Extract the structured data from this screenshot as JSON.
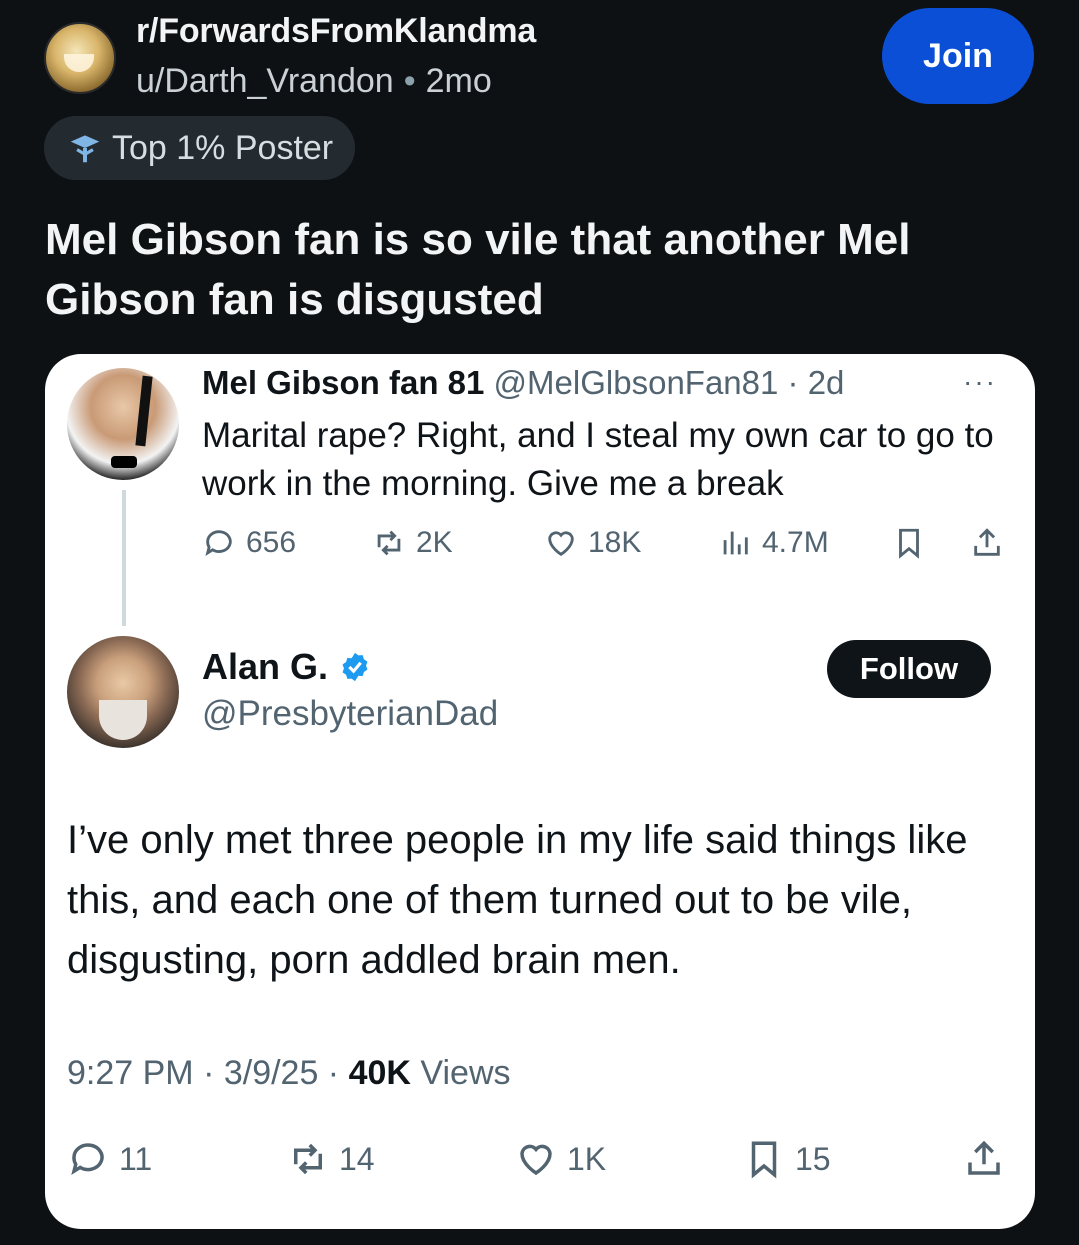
{
  "reddit": {
    "subreddit": "r/ForwardsFromKlandma",
    "username": "u/Darth_Vrandon",
    "separator": "•",
    "age": "2mo",
    "join_label": "Join",
    "flair": "Top 1% Poster",
    "post_title": "Mel Gibson fan is so vile that another Mel Gibson fan is disgusted"
  },
  "tweet1": {
    "name": "Mel Gibson fan 81",
    "handle_time": " @MelGlbsonFan81 · 2d",
    "more": "···",
    "text": "Marital rape? Right, and I steal my own car to go to work in the morning. Give me a break",
    "replies": "656",
    "reposts": "2K",
    "likes": "18K",
    "views": "4.7M"
  },
  "tweet2": {
    "name": "Alan G.",
    "handle": "@PresbyterianDad",
    "follow_label": "Follow",
    "text": "I’ve only met three people in my life said things like this, and each one of them turned out to be vile, disgusting, porn addled brain men.",
    "time": "9:27 PM · 3/9/25 · ",
    "views_count": "40K",
    "views_label": " Views",
    "replies": "11",
    "reposts": "14",
    "likes": "1K",
    "bookmarks": "15"
  },
  "colors": {
    "background": "#0e1113",
    "join_button": "#0a4fd6",
    "verified_badge": "#1d9bf0",
    "card": "#ffffff",
    "secondary_text": "#536471"
  }
}
